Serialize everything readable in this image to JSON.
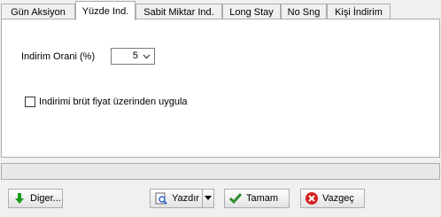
{
  "tabs": [
    {
      "label": "Gün Aksiyon",
      "active": false
    },
    {
      "label": "Yüzde Ind.",
      "active": true
    },
    {
      "label": "Sabit Miktar Ind.",
      "active": false
    },
    {
      "label": "Long Stay",
      "active": false
    },
    {
      "label": "No Sng",
      "active": false
    },
    {
      "label": "Kişi İndirim",
      "active": false
    }
  ],
  "form": {
    "rate_label": "Indirim Orani (%)",
    "rate_value": "5",
    "gross_checkbox_label": "Indirimi brüt fiyat üzerinden uygula",
    "gross_checked": false
  },
  "buttons": {
    "other": "Diger...",
    "print": "Yazdır",
    "ok": "Tamam",
    "cancel": "Vazgeç"
  },
  "colors": {
    "ok_icon": "#2e8b2e",
    "cancel_icon": "#d62020",
    "other_icon": "#1a9a1a"
  }
}
